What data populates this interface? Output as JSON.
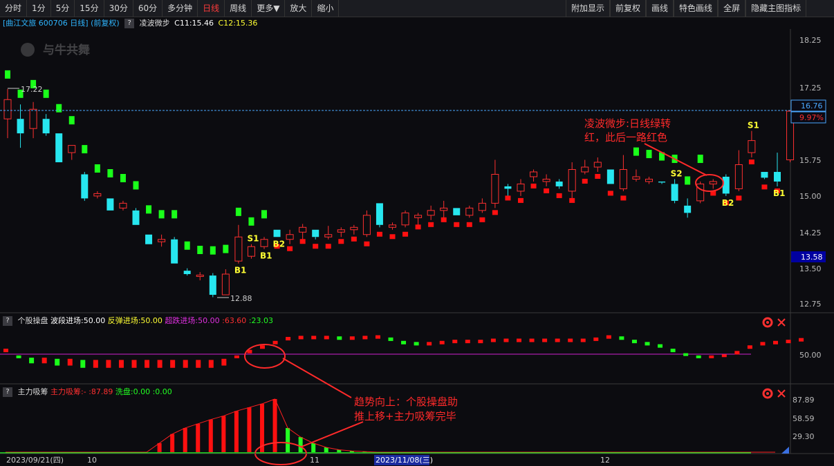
{
  "toolbar": {
    "left": [
      "分时",
      "1分",
      "5分",
      "15分",
      "30分",
      "60分",
      "多分钟",
      "日线",
      "周线",
      "更多▼",
      "放大",
      "缩小"
    ],
    "active": "日线",
    "right": [
      "附加显示",
      "前复权",
      "画线",
      "特色画线",
      "全屏",
      "隐藏主图指标"
    ]
  },
  "main_header": {
    "stock": "[曲江文旅 600706 日线]",
    "adjust": "(前复权)",
    "indicator": "凌波微步",
    "c1": "C11:15.46",
    "c2": "C12:15.36"
  },
  "watermark": "与牛共舞",
  "colors": {
    "up": "#ff3030",
    "down": "#27e6ef",
    "green": "#1aff1a",
    "red_marker": "#ff1010",
    "axis_text": "#bbbbbb",
    "magenta": "#d020d0"
  },
  "price_axis": {
    "ticks": [
      "18.25",
      "17.25",
      "15.75",
      "15.00",
      "14.25",
      "13.50",
      "12.75"
    ],
    "last_price": "16.76",
    "last_pct": "9.97%",
    "box_low": "13.58"
  },
  "price_labels": {
    "high": "17.22",
    "low": "12.88"
  },
  "signals": [
    {
      "text": "S1",
      "bar": 19
    },
    {
      "text": "B1",
      "bar": 18
    },
    {
      "text": "B1",
      "bar": 20
    },
    {
      "text": "B2",
      "bar": 21
    },
    {
      "text": "S2",
      "bar": 52
    },
    {
      "text": "B2",
      "bar": 56
    },
    {
      "text": "S1",
      "bar": 58
    },
    {
      "text": "B1",
      "bar": 60
    }
  ],
  "annotations": {
    "top": [
      "凌波微步:日线绿转",
      "红，此后一路红色"
    ],
    "bottom": [
      "趋势向上：个股操盘助",
      "推上移+主力吸筹完毕"
    ]
  },
  "panel2": {
    "title": "个股操盘",
    "bodong": "波段进场:50.00",
    "fantan": "反弹进场:50.00",
    "chaodie": "超跌进场:50.00",
    "v1": ":63.60",
    "v2": ":23.03",
    "axis": "50.00"
  },
  "panel3": {
    "title": "主力吸筹",
    "label1": "主力吸筹:-",
    "v1": ":87.89",
    "label2": "洗盘:0.00",
    "v2": ":0.00",
    "axis": [
      "87.89",
      "58.59",
      "29.30"
    ]
  },
  "date_axis": {
    "start": "2023/09/21(四)",
    "m1": "10",
    "m2": "11",
    "cursor": "2023/11/08(三)",
    "m3": "12"
  },
  "chart_data": {
    "type": "candlestick",
    "ylim": [
      12.5,
      18.5
    ],
    "candles": [
      {
        "o": 16.6,
        "h": 17.22,
        "l": 16.2,
        "c": 17.0
      },
      {
        "o": 16.6,
        "h": 16.9,
        "l": 16.0,
        "c": 16.3
      },
      {
        "o": 16.4,
        "h": 16.95,
        "l": 16.2,
        "c": 16.8
      },
      {
        "o": 16.6,
        "h": 16.7,
        "l": 16.25,
        "c": 16.3
      },
      {
        "o": 16.3,
        "h": 16.3,
        "l": 15.7,
        "c": 15.7
      },
      {
        "o": 15.9,
        "h": 16.05,
        "l": 15.75,
        "c": 16.05
      },
      {
        "o": 15.45,
        "h": 15.5,
        "l": 14.9,
        "c": 14.95
      },
      {
        "o": 15.0,
        "h": 15.1,
        "l": 14.95,
        "c": 15.05
      },
      {
        "o": 14.95,
        "h": 14.95,
        "l": 14.7,
        "c": 14.7
      },
      {
        "o": 14.75,
        "h": 14.9,
        "l": 14.7,
        "c": 14.85
      },
      {
        "o": 14.7,
        "h": 14.75,
        "l": 14.4,
        "c": 14.4
      },
      {
        "o": 14.2,
        "h": 14.2,
        "l": 14.0,
        "c": 14.0
      },
      {
        "o": 14.05,
        "h": 14.2,
        "l": 13.95,
        "c": 14.1
      },
      {
        "o": 14.1,
        "h": 14.15,
        "l": 13.6,
        "c": 13.6
      },
      {
        "o": 13.45,
        "h": 13.5,
        "l": 13.35,
        "c": 13.38
      },
      {
        "o": 13.33,
        "h": 13.42,
        "l": 13.25,
        "c": 13.36
      },
      {
        "o": 13.35,
        "h": 13.4,
        "l": 12.9,
        "c": 12.95
      },
      {
        "o": 12.95,
        "h": 13.48,
        "l": 12.95,
        "c": 13.38
      },
      {
        "o": 13.65,
        "h": 14.4,
        "l": 13.6,
        "c": 14.15
      },
      {
        "o": 13.75,
        "h": 14.0,
        "l": 13.7,
        "c": 13.95
      },
      {
        "o": 13.95,
        "h": 14.15,
        "l": 13.9,
        "c": 14.1
      },
      {
        "o": 14.3,
        "h": 14.3,
        "l": 14.15,
        "c": 14.15
      },
      {
        "o": 14.1,
        "h": 14.3,
        "l": 14.0,
        "c": 14.2
      },
      {
        "o": 14.25,
        "h": 14.42,
        "l": 14.1,
        "c": 14.35
      },
      {
        "o": 14.3,
        "h": 14.3,
        "l": 14.1,
        "c": 14.15
      },
      {
        "o": 14.15,
        "h": 14.38,
        "l": 14.1,
        "c": 14.2
      },
      {
        "o": 14.25,
        "h": 14.35,
        "l": 14.15,
        "c": 14.3
      },
      {
        "o": 14.3,
        "h": 14.4,
        "l": 14.2,
        "c": 14.35
      },
      {
        "o": 14.2,
        "h": 14.7,
        "l": 14.15,
        "c": 14.6
      },
      {
        "o": 14.85,
        "h": 14.85,
        "l": 14.35,
        "c": 14.4
      },
      {
        "o": 14.35,
        "h": 14.45,
        "l": 14.3,
        "c": 14.4
      },
      {
        "o": 14.4,
        "h": 14.7,
        "l": 14.35,
        "c": 14.65
      },
      {
        "o": 14.55,
        "h": 14.65,
        "l": 14.4,
        "c": 14.6
      },
      {
        "o": 14.6,
        "h": 14.8,
        "l": 14.5,
        "c": 14.7
      },
      {
        "o": 14.7,
        "h": 14.9,
        "l": 14.55,
        "c": 14.75
      },
      {
        "o": 14.75,
        "h": 14.75,
        "l": 14.6,
        "c": 14.6
      },
      {
        "o": 14.6,
        "h": 14.8,
        "l": 14.55,
        "c": 14.75
      },
      {
        "o": 14.7,
        "h": 14.95,
        "l": 14.65,
        "c": 14.85
      },
      {
        "o": 14.85,
        "h": 15.75,
        "l": 14.75,
        "c": 15.45
      },
      {
        "o": 15.2,
        "h": 15.25,
        "l": 14.95,
        "c": 15.15
      },
      {
        "o": 15.1,
        "h": 15.35,
        "l": 15.0,
        "c": 15.25
      },
      {
        "o": 15.4,
        "h": 15.55,
        "l": 15.3,
        "c": 15.5
      },
      {
        "o": 15.3,
        "h": 15.45,
        "l": 15.2,
        "c": 15.35
      },
      {
        "o": 15.3,
        "h": 15.35,
        "l": 15.15,
        "c": 15.2
      },
      {
        "o": 15.1,
        "h": 15.7,
        "l": 14.95,
        "c": 15.55
      },
      {
        "o": 15.5,
        "h": 15.75,
        "l": 15.45,
        "c": 15.6
      },
      {
        "o": 15.6,
        "h": 15.8,
        "l": 15.5,
        "c": 15.7
      },
      {
        "o": 15.55,
        "h": 15.55,
        "l": 15.25,
        "c": 15.25
      },
      {
        "o": 15.15,
        "h": 15.85,
        "l": 15.1,
        "c": 15.55
      },
      {
        "o": 15.35,
        "h": 15.55,
        "l": 15.3,
        "c": 15.4
      },
      {
        "o": 15.3,
        "h": 15.4,
        "l": 15.25,
        "c": 15.35
      },
      {
        "o": 15.3,
        "h": 15.3,
        "l": 15.25,
        "c": 15.28
      },
      {
        "o": 15.25,
        "h": 15.35,
        "l": 14.85,
        "c": 14.9
      },
      {
        "o": 14.8,
        "h": 14.95,
        "l": 14.55,
        "c": 14.65
      },
      {
        "o": 14.9,
        "h": 15.3,
        "l": 14.85,
        "c": 15.25
      },
      {
        "o": 15.25,
        "h": 15.35,
        "l": 15.15,
        "c": 15.3
      },
      {
        "o": 15.4,
        "h": 15.45,
        "l": 15.0,
        "c": 15.05
      },
      {
        "o": 15.15,
        "h": 15.95,
        "l": 15.1,
        "c": 15.65
      },
      {
        "o": 15.9,
        "h": 16.35,
        "l": 15.8,
        "c": 16.15
      },
      {
        "o": 15.5,
        "h": 15.5,
        "l": 15.35,
        "c": 15.38
      },
      {
        "o": 15.5,
        "h": 15.9,
        "l": 15.2,
        "c": 15.3
      },
      {
        "o": 15.75,
        "h": 16.76,
        "l": 15.7,
        "c": 16.76
      }
    ],
    "marker_color": [
      "g",
      "g",
      "g",
      "g",
      "g",
      "g",
      "g",
      "g",
      "g",
      "g",
      "g",
      "g",
      "g",
      "g",
      "g",
      "g",
      "g",
      "g",
      "g",
      "g",
      "g",
      "r",
      "r",
      "r",
      "r",
      "r",
      "r",
      "r",
      "r",
      "r",
      "r",
      "r",
      "r",
      "r",
      "r",
      "r",
      "r",
      "r",
      "r",
      "r",
      "r",
      "r",
      "r",
      "r",
      "r",
      "r",
      "r",
      "r",
      "r",
      "g",
      "g",
      "g",
      "g",
      "g",
      "g",
      "r",
      "r",
      "r",
      "r",
      "r",
      "r"
    ],
    "panel2_values": [
      53,
      47,
      45,
      45,
      44,
      44,
      43,
      43,
      43,
      43,
      43,
      43,
      43,
      43,
      43,
      43,
      43,
      44,
      47,
      52,
      56,
      60,
      63.5,
      64.5,
      64.5,
      64.5,
      64,
      64,
      64.5,
      65,
      63,
      60,
      59,
      59,
      60,
      61,
      61,
      61,
      62,
      62,
      62,
      62,
      62,
      62,
      62,
      62,
      63,
      65,
      64,
      61,
      59,
      57,
      53,
      49,
      47,
      47,
      48,
      51,
      56,
      59,
      60,
      61,
      62.5
    ],
    "panel3_values": [
      0,
      0,
      0,
      0,
      0,
      0,
      0,
      0,
      0,
      0,
      0,
      0,
      15,
      30,
      40,
      47,
      54,
      60,
      68,
      74,
      80,
      87.89,
      40,
      25,
      15,
      8,
      4,
      2,
      1,
      0,
      0,
      0,
      0,
      0,
      0,
      0,
      0,
      0,
      0,
      0,
      0,
      0,
      0,
      0,
      0,
      0,
      0,
      0,
      0,
      0,
      0,
      0,
      0,
      0,
      0,
      0,
      0,
      0,
      0,
      0,
      0
    ]
  }
}
